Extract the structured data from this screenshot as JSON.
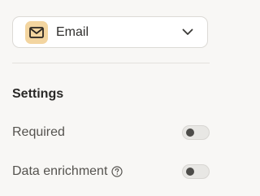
{
  "field_type_select": {
    "label": "Email",
    "icon": "envelope-icon",
    "icon_bg": "#f3d5a0"
  },
  "settings": {
    "title": "Settings",
    "required": {
      "label": "Required",
      "enabled": false
    },
    "data_enrichment": {
      "label": "Data enrichment",
      "help_icon": "question-circle-icon",
      "enabled": false
    }
  }
}
